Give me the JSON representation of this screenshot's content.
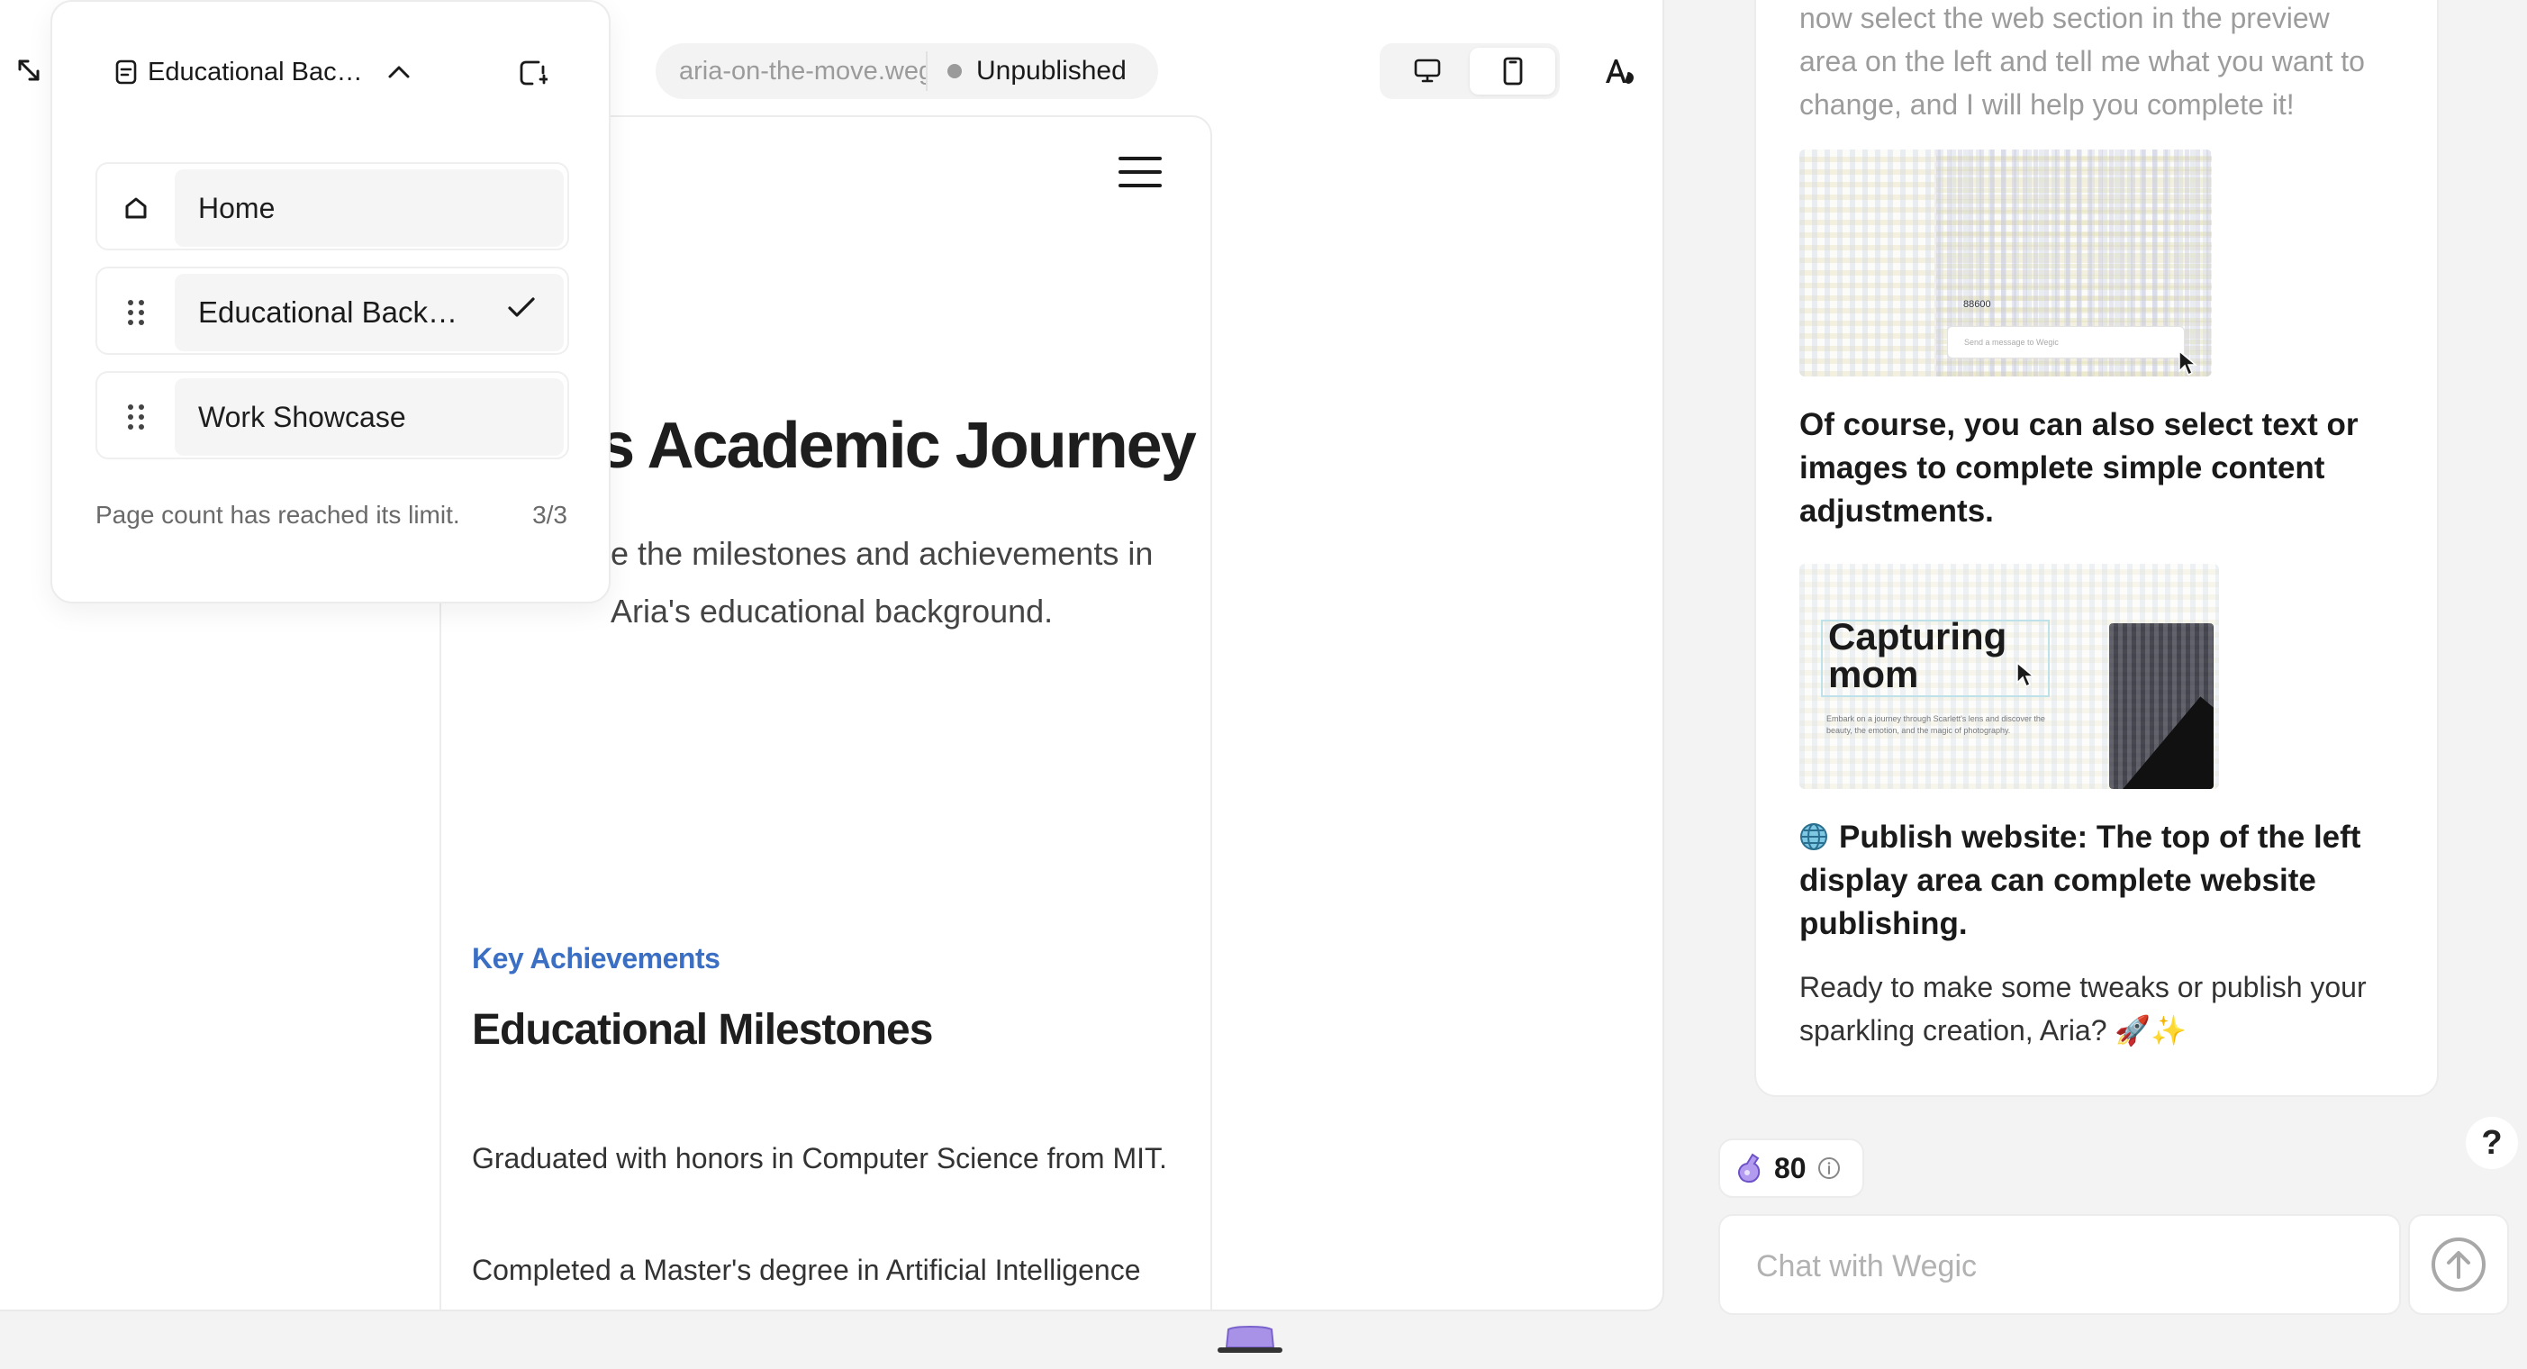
{
  "app": {
    "accent_color": "#3b6fc4"
  },
  "toolbar": {
    "url_text": "aria-on-the-move.wegic.app",
    "status_label": "Unpublished",
    "devices": [
      {
        "icon": "desktop-icon",
        "active": false
      },
      {
        "icon": "mobile-icon",
        "active": true
      }
    ]
  },
  "page_menu": {
    "current_page": "Educational Bac…",
    "pages": [
      {
        "label": "Home",
        "icon": "home-icon",
        "selected": false
      },
      {
        "label": "Educational Back…",
        "icon": "drag-handle-icon",
        "selected": true
      },
      {
        "label": "Work Showcase",
        "icon": "drag-handle-icon",
        "selected": false
      }
    ],
    "limit_note": "Page count has reached its limit.",
    "count": "3/3"
  },
  "preview": {
    "hero_title": "'s Academic Journey",
    "hero_desc_line1": "e the milestones and achievements in",
    "hero_desc_line2": "Aria's educational background.",
    "section_kicker": "Key Achievements",
    "section_title": "Educational Milestones",
    "milestones": [
      "Graduated with honors in Computer Science from MIT.",
      "Completed a Master's degree in Artificial Intelligence"
    ]
  },
  "chat": {
    "faded_text": "now select the web section in the preview area on the left and tell me what you want to change, and I will help you complete it!",
    "thumb1": {
      "badge": "88600",
      "input_placeholder": "Send a message to Wegic"
    },
    "para_select": "Of course, you can also select text or images to complete simple content adjustments.",
    "thumb2": {
      "title_line1": "Capturing",
      "title_line2": "mom",
      "desc": "Embark on a journey through Scarlett's lens and discover the beauty, the emotion, and the magic of photography."
    },
    "para_publish": "Publish website:  The top of the left display area can complete website publishing.",
    "para_ready": "Ready to make some tweaks or publish your sparkling creation, Aria? 🚀✨",
    "credits": "80",
    "help_label": "?",
    "input_placeholder": "Chat with Wegic"
  }
}
